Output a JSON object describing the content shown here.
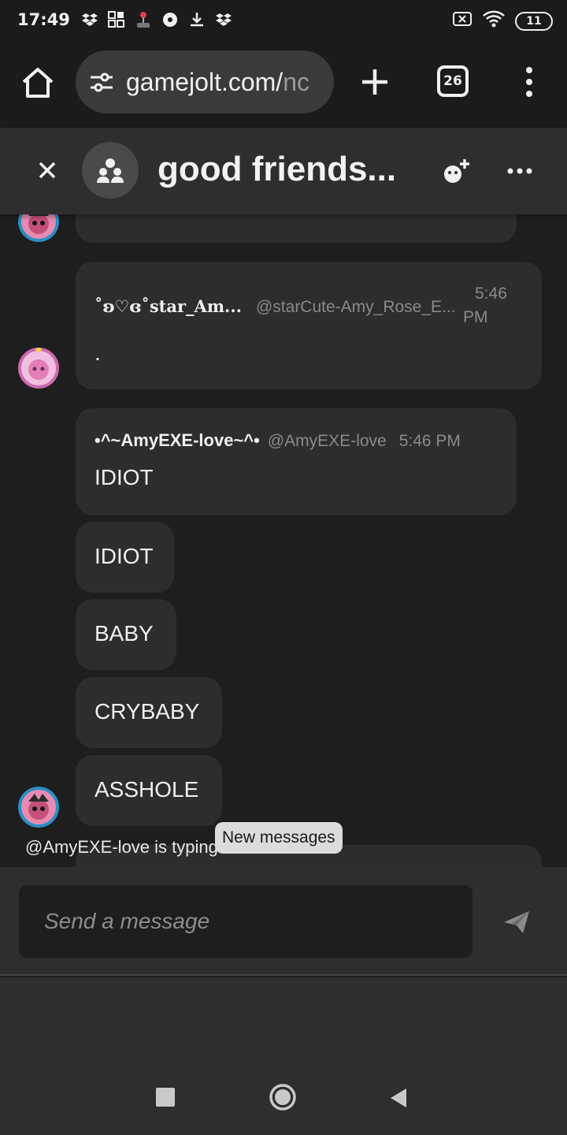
{
  "status": {
    "time": "17:49",
    "battery": "11"
  },
  "browser": {
    "url_main": "gamejolt.com/",
    "url_dim": "nc",
    "tab_count": "26"
  },
  "chat": {
    "title": "good friends..."
  },
  "messages": [
    {
      "username": "˚ʚ♡ɞ˚star_Am...",
      "handle": "@starCute-Amy_Rose_E...",
      "time_line1": "5:46",
      "time_line2": "PM",
      "text": "."
    },
    {
      "username": "•^~AmyEXE-love~^•",
      "handle": "@AmyEXE-love",
      "time": "5:46 PM",
      "text": "IDIOT"
    }
  ],
  "followups": [
    "IDIOT",
    "BABY",
    "CRYBABY",
    "ASSHOLE"
  ],
  "typing_indicator": "@AmyEXE-love is typing...",
  "new_messages_pill": "New messages",
  "composer": {
    "placeholder": "Send a message"
  },
  "colors": {
    "background": "#1e1e1e",
    "bubble": "#2d2d2d",
    "header": "#2e2e2e",
    "text": "#f0f0f0",
    "muted": "#8a8a8a"
  }
}
